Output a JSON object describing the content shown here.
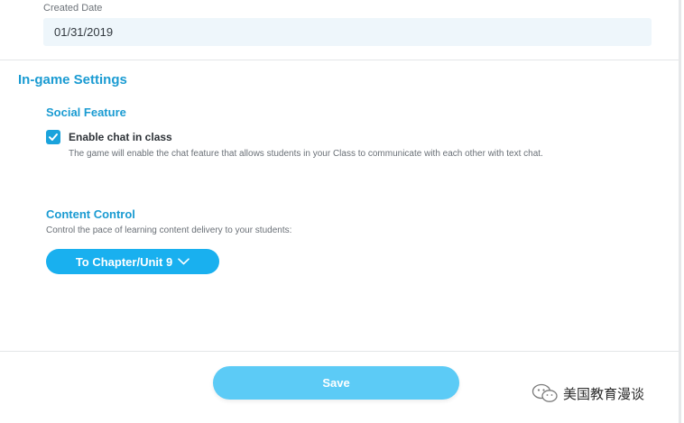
{
  "basic_info": {
    "created_label": "Created Date",
    "created_value": "01/31/2019"
  },
  "in_game": {
    "title": "In-game Settings",
    "social": {
      "title": "Social Feature",
      "chat_label": "Enable chat in class",
      "chat_checked": true,
      "chat_description": "The game will enable the chat feature that allows students in your Class to communicate with each other with text chat."
    },
    "content_control": {
      "title": "Content Control",
      "description": "Control the pace of learning content delivery to your students:",
      "selected_option": "To Chapter/Unit 9"
    }
  },
  "footer": {
    "save_label": "Save"
  },
  "watermark": {
    "text": "美国教育漫谈"
  },
  "colors": {
    "accent": "#1a9bd2",
    "button": "#19b0ef",
    "save_button": "#5ccbf6",
    "field_background": "#eef6fb"
  }
}
